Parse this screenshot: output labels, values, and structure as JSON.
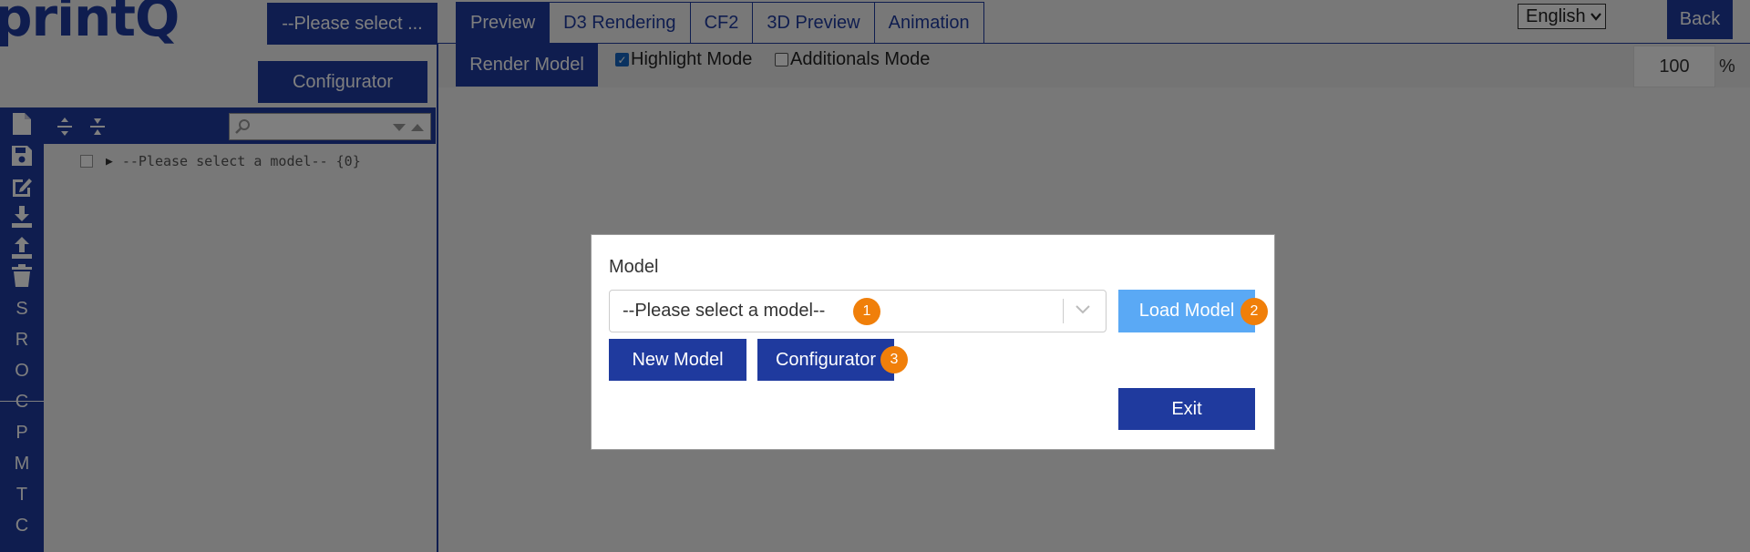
{
  "app": {
    "logo_text": "printQ"
  },
  "left_panel": {
    "model_select_label": "--Please select ...",
    "configurator_label": "Configurator",
    "tool_icons": [
      "new-file-icon",
      "save-icon",
      "edit-icon",
      "download-icon",
      "upload-icon",
      "delete-icon"
    ],
    "letters": [
      "S",
      "R",
      "O",
      "C",
      "P",
      "M",
      "T",
      "C"
    ],
    "tree": {
      "root_label": "--Please select a model-- {0}"
    }
  },
  "tabs": [
    {
      "label": "Preview",
      "active": true
    },
    {
      "label": "D3 Rendering",
      "active": false
    },
    {
      "label": "CF2",
      "active": false
    },
    {
      "label": "3D Preview",
      "active": false
    },
    {
      "label": "Animation",
      "active": false
    }
  ],
  "header": {
    "language": {
      "selected": "English"
    },
    "back_label": "Back"
  },
  "toolbar": {
    "render_label": "Render Model",
    "highlight_mode": {
      "label": "Highlight Mode",
      "checked": true
    },
    "additionals_mode": {
      "label": "Additionals Mode",
      "checked": false
    },
    "zoom_value": "100",
    "zoom_unit": "%"
  },
  "modal": {
    "label": "Model",
    "select_value": "--Please select a model--",
    "load_label": "Load Model",
    "new_label": "New Model",
    "configurator_label": "Configurator",
    "exit_label": "Exit",
    "badges": [
      "1",
      "2",
      "3"
    ]
  },
  "colors": {
    "primary": "#1f3a9e",
    "load_button": "#5aa9f5",
    "badge": "#f07f0a",
    "overlay": "rgba(0,0,0,0.5)"
  }
}
